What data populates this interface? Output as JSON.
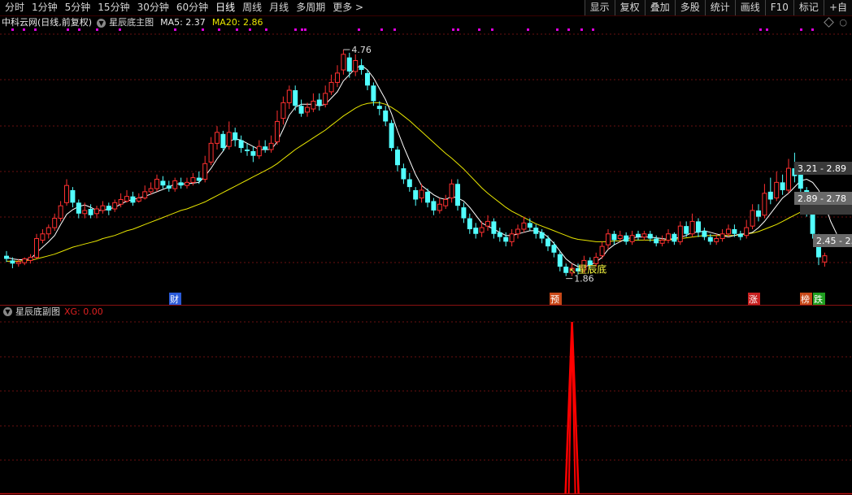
{
  "toolbar": {
    "periods": [
      "分时",
      "1分钟",
      "5分钟",
      "15分钟",
      "30分钟",
      "60分钟",
      "日线",
      "周线",
      "月线",
      "多周期",
      "更多 >"
    ],
    "active_period": "日线",
    "right_buttons": [
      "显示",
      "复权",
      "叠加",
      "多股",
      "统计",
      "画线",
      "F10",
      "标记",
      "+自"
    ]
  },
  "info": {
    "stock_title": "中科云网(日线,前复权)",
    "indicator_name": "星辰底主图",
    "ma5_label": "MA5: 2.37",
    "ma20_label": "MA20: 2.86"
  },
  "sub_panel": {
    "name": "星辰底副图",
    "xg_label": "XG: 0.00"
  },
  "annotations": {
    "high_price": "4.76",
    "low_price": "1.86",
    "signal_label": "星辰底",
    "range_labels": [
      "3.21 - 2.89",
      "2.89 - 2.78",
      "2.45 - 2."
    ]
  },
  "event_markers": [
    {
      "label": "财",
      "color": "#2a5ad8"
    },
    {
      "label": "预",
      "color": "#c84818"
    },
    {
      "label": "涨",
      "color": "#c82020"
    },
    {
      "label": "榜",
      "color": "#c84818"
    },
    {
      "label": "跌",
      "color": "#20a020"
    }
  ],
  "colors": {
    "up": "#ff3030",
    "down": "#52ffff",
    "ma5": "#ffffff",
    "ma20": "#e8e600",
    "signal": "#ff0000",
    "grid": "#6a1010",
    "tag": "#dd00dd"
  },
  "chart_data": {
    "type": "candlestick",
    "y_range": [
      1.7,
      5.0
    ],
    "candles": [
      [
        2.12,
        2.08,
        2.18,
        2.04
      ],
      [
        2.06,
        2.02,
        2.1,
        1.96
      ],
      [
        2.02,
        2.04,
        2.08,
        1.98
      ],
      [
        2.03,
        2.08,
        2.1,
        2.0
      ],
      [
        2.06,
        2.1,
        2.14,
        2.02
      ],
      [
        2.1,
        2.34,
        2.4,
        2.08
      ],
      [
        2.32,
        2.4,
        2.46,
        2.28
      ],
      [
        2.4,
        2.48,
        2.52,
        2.34
      ],
      [
        2.48,
        2.6,
        2.66,
        2.44
      ],
      [
        2.6,
        2.76,
        2.82,
        2.56
      ],
      [
        2.8,
        3.02,
        3.1,
        2.76
      ],
      [
        2.96,
        2.8,
        3.0,
        2.74
      ],
      [
        2.8,
        2.66,
        2.84,
        2.6
      ],
      [
        2.66,
        2.7,
        2.8,
        2.6
      ],
      [
        2.72,
        2.64,
        2.78,
        2.6
      ],
      [
        2.66,
        2.72,
        2.76,
        2.6
      ],
      [
        2.7,
        2.76,
        2.82,
        2.66
      ],
      [
        2.76,
        2.7,
        2.8,
        2.64
      ],
      [
        2.72,
        2.8,
        2.84,
        2.68
      ],
      [
        2.78,
        2.84,
        2.92,
        2.74
      ],
      [
        2.82,
        2.88,
        2.96,
        2.8
      ],
      [
        2.88,
        2.8,
        2.94,
        2.76
      ],
      [
        2.82,
        2.86,
        2.92,
        2.8
      ],
      [
        2.86,
        2.94,
        3.02,
        2.84
      ],
      [
        2.94,
        2.98,
        3.06,
        2.9
      ],
      [
        2.98,
        3.1,
        3.16,
        2.94
      ],
      [
        3.08,
        3.02,
        3.14,
        2.98
      ],
      [
        3.02,
        2.98,
        3.08,
        2.94
      ],
      [
        2.98,
        3.08,
        3.12,
        2.94
      ],
      [
        3.06,
        3.02,
        3.12,
        2.98
      ],
      [
        3.02,
        3.06,
        3.12,
        2.98
      ],
      [
        3.06,
        3.12,
        3.18,
        3.02
      ],
      [
        3.12,
        3.08,
        3.2,
        3.04
      ],
      [
        3.1,
        3.3,
        3.4,
        3.06
      ],
      [
        3.32,
        3.56,
        3.64,
        3.28
      ],
      [
        3.56,
        3.7,
        3.78,
        3.48
      ],
      [
        3.68,
        3.5,
        3.72,
        3.46
      ],
      [
        3.52,
        3.7,
        3.84,
        3.48
      ],
      [
        3.7,
        3.6,
        3.76,
        3.52
      ],
      [
        3.6,
        3.5,
        3.66,
        3.44
      ],
      [
        3.48,
        3.46,
        3.56,
        3.4
      ],
      [
        3.46,
        3.4,
        3.52,
        3.32
      ],
      [
        3.4,
        3.52,
        3.6,
        3.36
      ],
      [
        3.52,
        3.48,
        3.6,
        3.44
      ],
      [
        3.48,
        3.56,
        3.66,
        3.44
      ],
      [
        3.58,
        3.84,
        3.98,
        3.54
      ],
      [
        3.88,
        4.08,
        4.16,
        3.8
      ],
      [
        4.08,
        4.24,
        4.3,
        4.0
      ],
      [
        4.24,
        4.04,
        4.3,
        3.98
      ],
      [
        4.04,
        3.94,
        4.12,
        3.9
      ],
      [
        3.96,
        4.02,
        4.08,
        3.9
      ],
      [
        4.0,
        4.1,
        4.2,
        3.96
      ],
      [
        4.12,
        4.04,
        4.2,
        3.98
      ],
      [
        4.06,
        4.2,
        4.3,
        4.02
      ],
      [
        4.22,
        4.34,
        4.44,
        4.18
      ],
      [
        4.34,
        4.46,
        4.56,
        4.28
      ],
      [
        4.5,
        4.7,
        4.76,
        4.44
      ],
      [
        4.66,
        4.48,
        4.72,
        4.4
      ],
      [
        4.48,
        4.62,
        4.7,
        4.42
      ],
      [
        4.56,
        4.5,
        4.64,
        4.44
      ],
      [
        4.46,
        4.3,
        4.5,
        4.24
      ],
      [
        4.3,
        4.1,
        4.34,
        4.04
      ],
      [
        4.04,
        4.0,
        4.1,
        3.92
      ],
      [
        3.98,
        3.84,
        4.04,
        3.78
      ],
      [
        3.82,
        3.5,
        3.86,
        3.46
      ],
      [
        3.48,
        3.28,
        3.52,
        3.2
      ],
      [
        3.24,
        3.1,
        3.3,
        3.04
      ],
      [
        3.1,
        3.0,
        3.18,
        2.94
      ],
      [
        2.96,
        2.84,
        3.0,
        2.76
      ],
      [
        2.86,
        2.96,
        3.04,
        2.8
      ],
      [
        2.94,
        2.8,
        2.98,
        2.74
      ],
      [
        2.82,
        2.7,
        2.86,
        2.64
      ],
      [
        2.7,
        2.78,
        2.86,
        2.66
      ],
      [
        2.76,
        2.84,
        2.9,
        2.72
      ],
      [
        2.86,
        3.04,
        3.1,
        2.8
      ],
      [
        3.04,
        2.76,
        3.1,
        2.7
      ],
      [
        2.74,
        2.6,
        2.8,
        2.54
      ],
      [
        2.6,
        2.46,
        2.66,
        2.4
      ],
      [
        2.48,
        2.4,
        2.54,
        2.34
      ],
      [
        2.42,
        2.48,
        2.56,
        2.36
      ],
      [
        2.5,
        2.56,
        2.64,
        2.44
      ],
      [
        2.56,
        2.4,
        2.6,
        2.34
      ],
      [
        2.42,
        2.36,
        2.48,
        2.3
      ],
      [
        2.36,
        2.3,
        2.42,
        2.24
      ],
      [
        2.3,
        2.4,
        2.46,
        2.24
      ],
      [
        2.4,
        2.46,
        2.52,
        2.34
      ],
      [
        2.46,
        2.54,
        2.62,
        2.42
      ],
      [
        2.54,
        2.48,
        2.6,
        2.44
      ],
      [
        2.48,
        2.4,
        2.52,
        2.34
      ],
      [
        2.42,
        2.34,
        2.46,
        2.28
      ],
      [
        2.34,
        2.24,
        2.38,
        2.18
      ],
      [
        2.26,
        2.16,
        2.3,
        2.1
      ],
      [
        2.14,
        1.98,
        2.18,
        1.92
      ],
      [
        1.98,
        1.9,
        2.02,
        1.86
      ],
      [
        1.9,
        1.96,
        2.02,
        1.86
      ],
      [
        1.96,
        1.92,
        2.02,
        1.88
      ],
      [
        1.94,
        2.06,
        2.12,
        1.9
      ],
      [
        2.06,
        2.0,
        2.1,
        1.96
      ],
      [
        2.02,
        2.1,
        2.16,
        1.98
      ],
      [
        2.12,
        2.24,
        2.3,
        2.08
      ],
      [
        2.26,
        2.4,
        2.46,
        2.2
      ],
      [
        2.4,
        2.32,
        2.44,
        2.26
      ],
      [
        2.34,
        2.38,
        2.44,
        2.3
      ],
      [
        2.38,
        2.3,
        2.42,
        2.26
      ],
      [
        2.3,
        2.38,
        2.44,
        2.26
      ],
      [
        2.4,
        2.36,
        2.44,
        2.32
      ],
      [
        2.36,
        2.4,
        2.44,
        2.32
      ],
      [
        2.4,
        2.34,
        2.44,
        2.3
      ],
      [
        2.34,
        2.28,
        2.38,
        2.24
      ],
      [
        2.28,
        2.32,
        2.38,
        2.24
      ],
      [
        2.32,
        2.4,
        2.46,
        2.28
      ],
      [
        2.4,
        2.3,
        2.42,
        2.26
      ],
      [
        2.3,
        2.5,
        2.56,
        2.26
      ],
      [
        2.5,
        2.4,
        2.56,
        2.36
      ],
      [
        2.4,
        2.56,
        2.66,
        2.36
      ],
      [
        2.56,
        2.42,
        2.6,
        2.36
      ],
      [
        2.44,
        2.36,
        2.48,
        2.32
      ],
      [
        2.36,
        2.3,
        2.4,
        2.26
      ],
      [
        2.3,
        2.34,
        2.4,
        2.26
      ],
      [
        2.34,
        2.4,
        2.46,
        2.3
      ],
      [
        2.4,
        2.46,
        2.52,
        2.36
      ],
      [
        2.46,
        2.4,
        2.52,
        2.36
      ],
      [
        2.4,
        2.36,
        2.44,
        2.32
      ],
      [
        2.38,
        2.48,
        2.58,
        2.34
      ],
      [
        2.5,
        2.7,
        2.78,
        2.46
      ],
      [
        2.7,
        2.62,
        2.78,
        2.56
      ],
      [
        2.64,
        2.92,
        3.04,
        2.6
      ],
      [
        2.94,
        2.84,
        3.12,
        2.78
      ],
      [
        2.86,
        3.06,
        3.2,
        2.82
      ],
      [
        3.06,
        2.96,
        3.16,
        2.9
      ],
      [
        2.96,
        3.24,
        3.36,
        2.92
      ],
      [
        3.24,
        3.14,
        3.44,
        3.06
      ],
      [
        3.16,
        2.98,
        3.2,
        2.9
      ],
      [
        2.96,
        2.7,
        3.0,
        2.62
      ],
      [
        2.68,
        2.4,
        2.72,
        2.34
      ],
      [
        2.36,
        2.1,
        2.4,
        2.0
      ],
      [
        2.04,
        2.12,
        2.16,
        1.98
      ]
    ],
    "ma5": [
      2.1,
      2.08,
      2.07,
      2.07,
      2.08,
      2.16,
      2.23,
      2.3,
      2.38,
      2.52,
      2.65,
      2.71,
      2.75,
      2.77,
      2.74,
      2.7,
      2.7,
      2.72,
      2.74,
      2.78,
      2.82,
      2.84,
      2.86,
      2.88,
      2.91,
      2.94,
      2.97,
      3.0,
      3.04,
      3.04,
      3.04,
      3.05,
      3.06,
      3.14,
      3.24,
      3.36,
      3.46,
      3.58,
      3.62,
      3.6,
      3.56,
      3.52,
      3.48,
      3.48,
      3.48,
      3.58,
      3.74,
      3.92,
      4.02,
      4.06,
      4.06,
      4.06,
      4.04,
      4.06,
      4.14,
      4.22,
      4.36,
      4.44,
      4.52,
      4.56,
      4.5,
      4.4,
      4.26,
      4.12,
      3.94,
      3.72,
      3.52,
      3.34,
      3.16,
      3.02,
      2.96,
      2.9,
      2.86,
      2.84,
      2.88,
      2.86,
      2.82,
      2.74,
      2.64,
      2.54,
      2.5,
      2.46,
      2.42,
      2.38,
      2.38,
      2.4,
      2.42,
      2.44,
      2.44,
      2.42,
      2.36,
      2.28,
      2.18,
      2.08,
      2.02,
      1.98,
      1.98,
      2.0,
      2.04,
      2.1,
      2.2,
      2.26,
      2.3,
      2.34,
      2.35,
      2.36,
      2.36,
      2.36,
      2.35,
      2.34,
      2.33,
      2.34,
      2.36,
      2.38,
      2.42,
      2.42,
      2.44,
      2.42,
      2.4,
      2.38,
      2.36,
      2.38,
      2.4,
      2.4,
      2.42,
      2.48,
      2.56,
      2.66,
      2.76,
      2.86,
      2.92,
      3.0,
      3.08,
      3.1,
      3.06,
      2.96,
      2.78,
      2.56,
      2.4
    ],
    "ma20": [
      2.05,
      2.05,
      2.05,
      2.06,
      2.06,
      2.08,
      2.1,
      2.12,
      2.14,
      2.17,
      2.2,
      2.23,
      2.25,
      2.27,
      2.29,
      2.31,
      2.34,
      2.36,
      2.38,
      2.41,
      2.44,
      2.46,
      2.49,
      2.52,
      2.55,
      2.58,
      2.61,
      2.64,
      2.67,
      2.7,
      2.72,
      2.75,
      2.78,
      2.81,
      2.85,
      2.89,
      2.93,
      2.97,
      3.01,
      3.05,
      3.09,
      3.13,
      3.17,
      3.21,
      3.25,
      3.3,
      3.36,
      3.42,
      3.48,
      3.53,
      3.58,
      3.63,
      3.68,
      3.73,
      3.79,
      3.85,
      3.91,
      3.96,
      4.01,
      4.05,
      4.07,
      4.08,
      4.08,
      4.06,
      4.02,
      3.97,
      3.91,
      3.85,
      3.78,
      3.71,
      3.64,
      3.57,
      3.5,
      3.43,
      3.37,
      3.3,
      3.23,
      3.15,
      3.07,
      2.99,
      2.92,
      2.86,
      2.8,
      2.74,
      2.69,
      2.65,
      2.61,
      2.57,
      2.53,
      2.5,
      2.47,
      2.44,
      2.41,
      2.38,
      2.35,
      2.33,
      2.32,
      2.31,
      2.3,
      2.3,
      2.3,
      2.31,
      2.31,
      2.32,
      2.32,
      2.32,
      2.32,
      2.32,
      2.32,
      2.32,
      2.32,
      2.33,
      2.34,
      2.35,
      2.36,
      2.37,
      2.38,
      2.38,
      2.38,
      2.38,
      2.38,
      2.38,
      2.39,
      2.4,
      2.41,
      2.43,
      2.46,
      2.49,
      2.52,
      2.56,
      2.6,
      2.64,
      2.68,
      2.72,
      2.76,
      2.79,
      2.8,
      2.8,
      2.79
    ],
    "xg_spike_index": 94,
    "ma5_current": 2.37,
    "ma20_current": 2.86,
    "high": 4.76,
    "low": 1.86
  }
}
